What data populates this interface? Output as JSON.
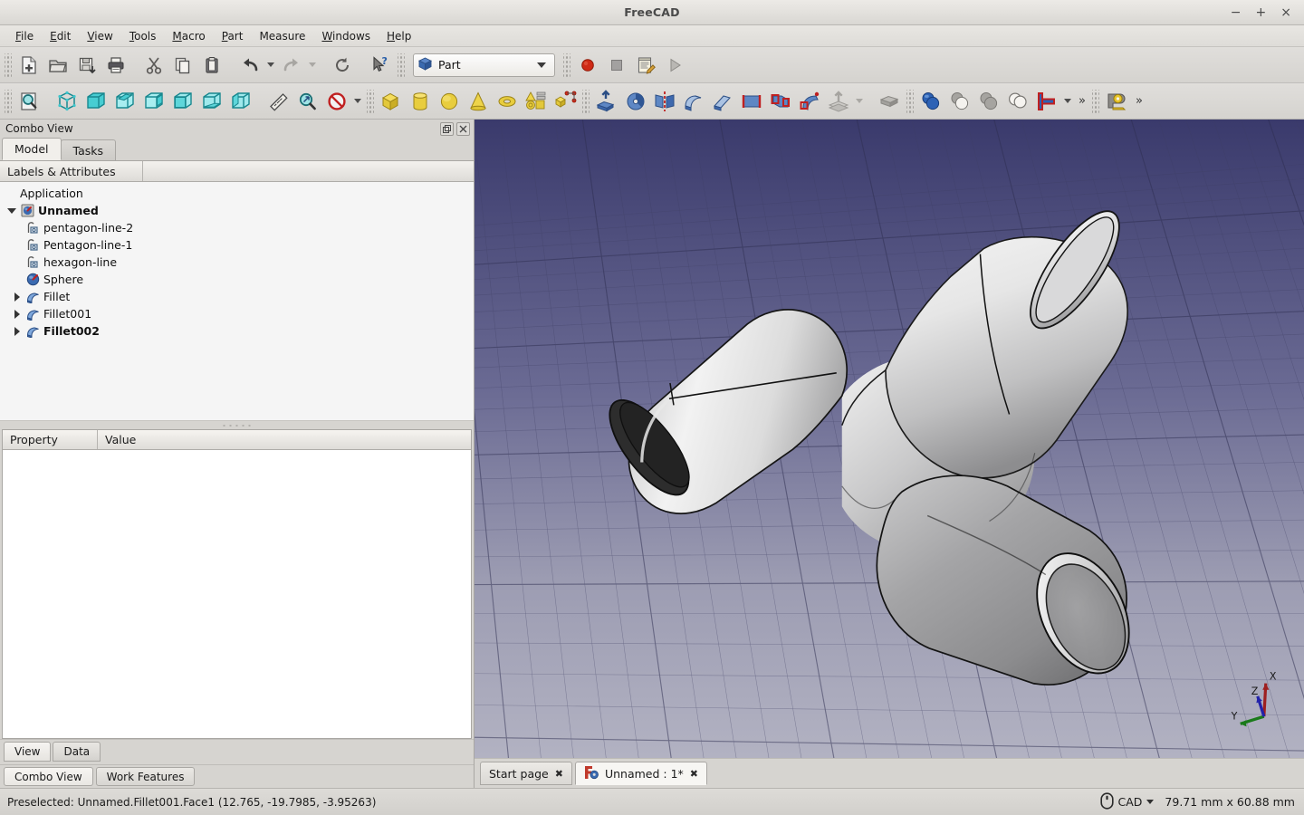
{
  "window": {
    "title": "FreeCAD",
    "minimize": "−",
    "maximize": "+",
    "close": "×"
  },
  "menubar": {
    "items": [
      {
        "label": "File",
        "mnemonic": "F"
      },
      {
        "label": "Edit",
        "mnemonic": "E"
      },
      {
        "label": "View",
        "mnemonic": "V"
      },
      {
        "label": "Tools",
        "mnemonic": "T"
      },
      {
        "label": "Macro",
        "mnemonic": "M"
      },
      {
        "label": "Part",
        "mnemonic": "P"
      },
      {
        "label": "Measure",
        "mnemonic": "M"
      },
      {
        "label": "Windows",
        "mnemonic": "W"
      },
      {
        "label": "Help",
        "mnemonic": "H"
      }
    ]
  },
  "toolbars": {
    "file": [
      "new-document-icon",
      "open-document-icon",
      "save-document-icon",
      "print-icon",
      "cut-icon",
      "copy-icon",
      "paste-icon",
      "undo-icon",
      "undo-dropdown-icon",
      "redo-icon",
      "redo-dropdown-icon",
      "refresh-icon",
      "whats-this-icon"
    ],
    "workbench": {
      "selected": "Part",
      "icon": "part-workbench-icon"
    },
    "macro": [
      "macro-record-icon",
      "macro-stop-icon",
      "macro-editor-icon",
      "macro-execute-icon"
    ],
    "view": [
      "fit-all-icon",
      "axonometric-icon",
      "front-view-icon",
      "top-view-icon",
      "right-view-icon",
      "rear-view-icon",
      "bottom-view-icon",
      "left-view-icon",
      "measure-distance-icon",
      "zoom-icon",
      "draw-style-icon",
      "draw-style-dropdown-icon"
    ],
    "primitives": [
      "box-icon",
      "cylinder-icon",
      "sphere-icon",
      "cone-icon",
      "torus-icon",
      "primitives-dialog-icon",
      "shape-builder-icon"
    ],
    "modeling": [
      "extrude-icon",
      "revolve-icon",
      "mirror-icon",
      "fillet-icon",
      "chamfer-icon",
      "ruled-surface-icon",
      "loft-icon",
      "sweep-icon",
      "section-icon",
      "section-dropdown-icon"
    ],
    "boolean": [
      "compound-icon",
      "boolean-icon",
      "cut-icon",
      "union-icon",
      "intersection-icon",
      "join-connect-icon",
      "join-dropdown-icon"
    ],
    "overflow_label": "»",
    "measure_icon": "measure-tape-icon",
    "overflow_label2": "»"
  },
  "combo_view": {
    "title": "Combo View",
    "float_button": "❐",
    "close_button": "✕",
    "tabs": [
      {
        "label": "Model",
        "active": true
      },
      {
        "label": "Tasks",
        "active": false
      }
    ],
    "tree_columns": [
      "Labels & Attributes",
      ""
    ],
    "tree": [
      {
        "label": "Application",
        "level": 0,
        "icon": null,
        "twist": null,
        "bold": false
      },
      {
        "label": "Unnamed",
        "level": 1,
        "icon": "document-icon",
        "twist": "down",
        "bold": true
      },
      {
        "label": "pentagon-line-2",
        "level": 2,
        "icon": "wire-icon",
        "twist": null,
        "bold": false
      },
      {
        "label": "Pentagon-line-1",
        "level": 2,
        "icon": "wire-icon",
        "twist": null,
        "bold": false
      },
      {
        "label": "hexagon-line",
        "level": 2,
        "icon": "wire-icon",
        "twist": null,
        "bold": false
      },
      {
        "label": "Sphere",
        "level": 2,
        "icon": "sphere-tree-icon",
        "twist": null,
        "bold": false
      },
      {
        "label": "Fillet",
        "level": 2,
        "icon": "fillet-tree-icon",
        "twist": "right",
        "bold": false
      },
      {
        "label": "Fillet001",
        "level": 2,
        "icon": "fillet-tree-icon",
        "twist": "right",
        "bold": false
      },
      {
        "label": "Fillet002",
        "level": 2,
        "icon": "fillet-tree-icon",
        "twist": "right",
        "bold": true
      }
    ],
    "property_columns": [
      "Property",
      "Value"
    ],
    "property_rows": [],
    "view_data_tabs": [
      {
        "label": "View",
        "active": true
      },
      {
        "label": "Data",
        "active": false
      }
    ]
  },
  "dock_tabs": [
    {
      "label": "Combo View",
      "active": true
    },
    {
      "label": "Work Features",
      "active": false
    }
  ],
  "document_tabs": [
    {
      "label": "Start page",
      "active": false,
      "icon": null,
      "close": "✖"
    },
    {
      "label": "Unnamed : 1*",
      "active": true,
      "icon": "freecad-logo-icon",
      "close": "✖"
    }
  ],
  "viewport": {
    "background_top": "#3c3c6e",
    "background_bottom": "#b0b0c0",
    "grid_color": "#4a4a70",
    "model_name": "pipe-tee-fillet-model",
    "axis_indicator": {
      "x_label": "X",
      "x_color": "#b22222",
      "y_label": "Y",
      "y_color": "#1a7a1a",
      "z_label": "Z",
      "z_color": "#2222aa"
    }
  },
  "statusbar": {
    "preselection": "Preselected: Unnamed.Fillet001.Face1 (12.765, -19.7985, -3.95263)",
    "nav_icon": "mouse-icon",
    "nav_style": "CAD",
    "dimensions": "79.71 mm x 60.88 mm"
  }
}
